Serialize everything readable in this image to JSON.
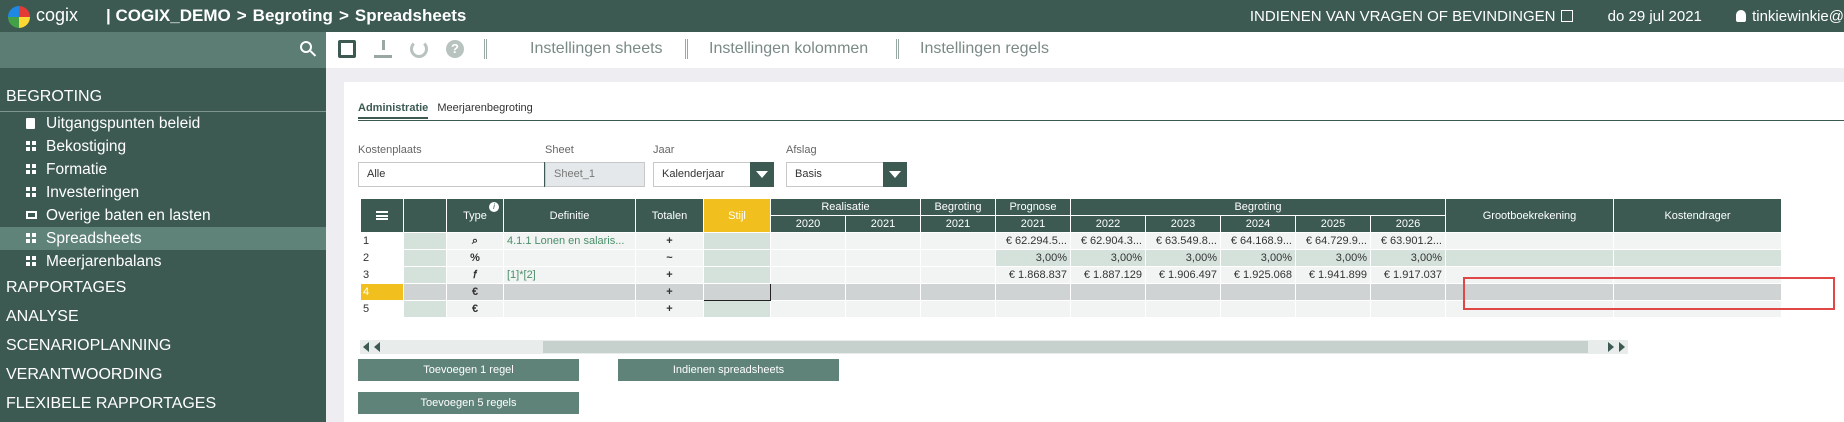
{
  "topbar": {
    "logo_text": "cogix",
    "crumbs": [
      "| COGIX_DEMO",
      ">",
      "Begroting",
      ">",
      "Spreadsheets"
    ],
    "report_link": "INDIENEN VAN VRAGEN OF BEVINDINGEN",
    "date": "do 29 jul 2021",
    "user": "tinkiewinkie@"
  },
  "sidebar": {
    "section_begroting": "BEGROTING",
    "items": [
      {
        "label": "Uitgangspunten beleid",
        "icon": "document-icon"
      },
      {
        "label": "Bekostiging",
        "icon": "grid-icon"
      },
      {
        "label": "Formatie",
        "icon": "grid-icon"
      },
      {
        "label": "Investeringen",
        "icon": "grid-icon"
      },
      {
        "label": "Overige baten en lasten",
        "icon": "monitor-icon"
      },
      {
        "label": "Spreadsheets",
        "icon": "grid-icon",
        "active": true
      },
      {
        "label": "Meerjarenbalans",
        "icon": "grid-icon"
      }
    ],
    "sections": [
      "RAPPORTAGES",
      "ANALYSE",
      "SCENARIOPLANNING",
      "VERANTWOORDING",
      "FLEXIBELE RAPPORTAGES"
    ]
  },
  "toolbar": {
    "sheets_settings": "Instellingen sheets",
    "columns_settings": "Instellingen kolommen",
    "rows_settings": "Instellingen regels"
  },
  "tabs": [
    "Administratie",
    "Meerjarenbegroting"
  ],
  "filters": {
    "kostenplaats": {
      "label": "Kostenplaats",
      "value": "Alle"
    },
    "sheet": {
      "label": "Sheet",
      "value": "Sheet_1"
    },
    "jaar": {
      "label": "Jaar",
      "value": "Kalenderjaar"
    },
    "afslag": {
      "label": "Afslag",
      "value": "Basis"
    }
  },
  "grid": {
    "headers": {
      "type": "Type",
      "definitie": "Definitie",
      "totalen": "Totalen",
      "stijl": "Stijl",
      "realisatie": "Realisatie",
      "begroting": "Begroting",
      "prognose": "Prognose",
      "begroting_group": "Begroting",
      "grootboek": "Grootboekrekening",
      "kostendrager": "Kostendrager"
    },
    "years": {
      "r2020": "2020",
      "r2021": "2021",
      "b2021": "2021",
      "p2021": "2021",
      "y2022": "2022",
      "y2023": "2023",
      "y2024": "2024",
      "y2025": "2025",
      "y2026": "2026"
    },
    "rows": [
      {
        "n": "1",
        "type": "⌕",
        "def": "4.1.1 Lonen en salaris...",
        "tot": "+",
        "vals": [
          "",
          "",
          "",
          "€ 62.294.5...",
          "€ 62.904.3...",
          "€ 63.549.8...",
          "€ 64.168.9...",
          "€ 64.729.9...",
          "€ 63.901.2..."
        ]
      },
      {
        "n": "2",
        "type": "%",
        "def": "",
        "tot": "~",
        "vals": [
          "",
          "",
          "",
          "",
          "3,00%",
          "3,00%",
          "3,00%",
          "3,00%",
          "3,00%",
          "3,00%"
        ]
      },
      {
        "n": "3",
        "type": "𝑓",
        "def": "[1]*[2]",
        "tot": "+",
        "vals": [
          "",
          "",
          "",
          "€ 1.868.837",
          "€ 1.887.129",
          "€ 1.906.497",
          "€ 1.925.068",
          "€ 1.941.899",
          "€ 1.917.037"
        ]
      },
      {
        "n": "4",
        "type": "€",
        "def": "",
        "tot": "+",
        "vals": [
          "",
          "",
          "",
          "",
          "",
          "",
          "",
          "",
          ""
        ]
      },
      {
        "n": "5",
        "type": "€",
        "def": "",
        "tot": "+",
        "vals": [
          "",
          "",
          "",
          "",
          "",
          "",
          "",
          "",
          ""
        ]
      }
    ]
  },
  "buttons": {
    "add_one": "Toevoegen 1 regel",
    "submit": "Indienen spreadsheets",
    "add_five": "Toevoegen 5 regels"
  }
}
